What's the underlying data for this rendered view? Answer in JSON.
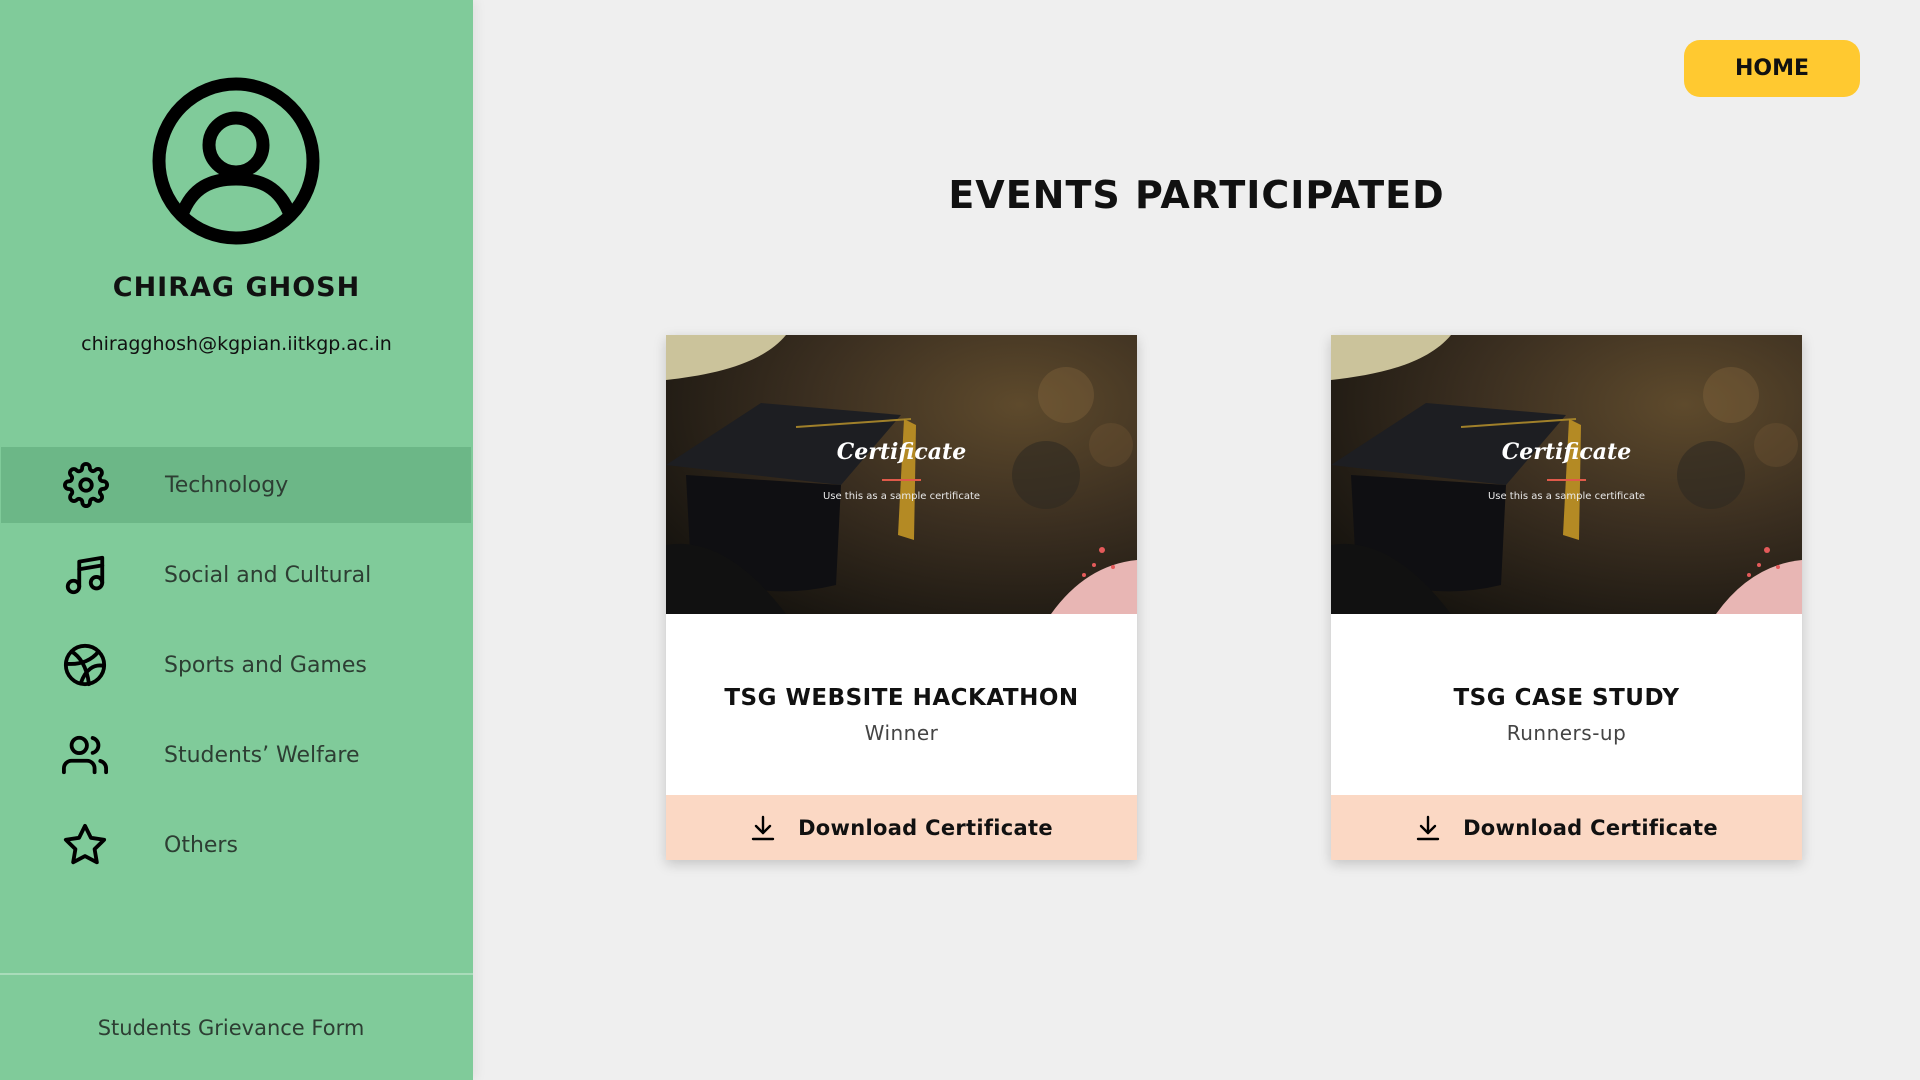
{
  "profile": {
    "name": "CHIRAG GHOSH",
    "email": "chiragghosh@kgpian.iitkgp.ac.in"
  },
  "sidebar": {
    "items": [
      {
        "label": "Technology",
        "icon": "gear-icon",
        "active": true
      },
      {
        "label": "Social and Cultural",
        "icon": "music-icon",
        "active": false
      },
      {
        "label": "Sports and Games",
        "icon": "basketball-icon",
        "active": false
      },
      {
        "label": "Students’ Welfare",
        "icon": "users-icon",
        "active": false
      },
      {
        "label": "Others",
        "icon": "star-icon",
        "active": false
      }
    ],
    "footer_link": "Students Grievance Form"
  },
  "header": {
    "home_label": "HOME",
    "page_title": "EVENTS PARTICIPATED"
  },
  "events": [
    {
      "name": "TSG WEBSITE HACKATHON",
      "result": "Winner",
      "certificate_title": "Certificate",
      "certificate_subtitle": "Use this as a sample certificate",
      "download_label": "Download Certificate"
    },
    {
      "name": "TSG CASE STUDY",
      "result": "Runners-up",
      "certificate_title": "Certificate",
      "certificate_subtitle": "Use this as a sample certificate",
      "download_label": "Download Certificate"
    }
  ],
  "colors": {
    "sidebar_bg": "#80cb9a",
    "sidebar_active": "#6cb787",
    "home_button": "#ffc930",
    "download_bg": "#fbd8c4",
    "page_bg": "#efefef"
  }
}
